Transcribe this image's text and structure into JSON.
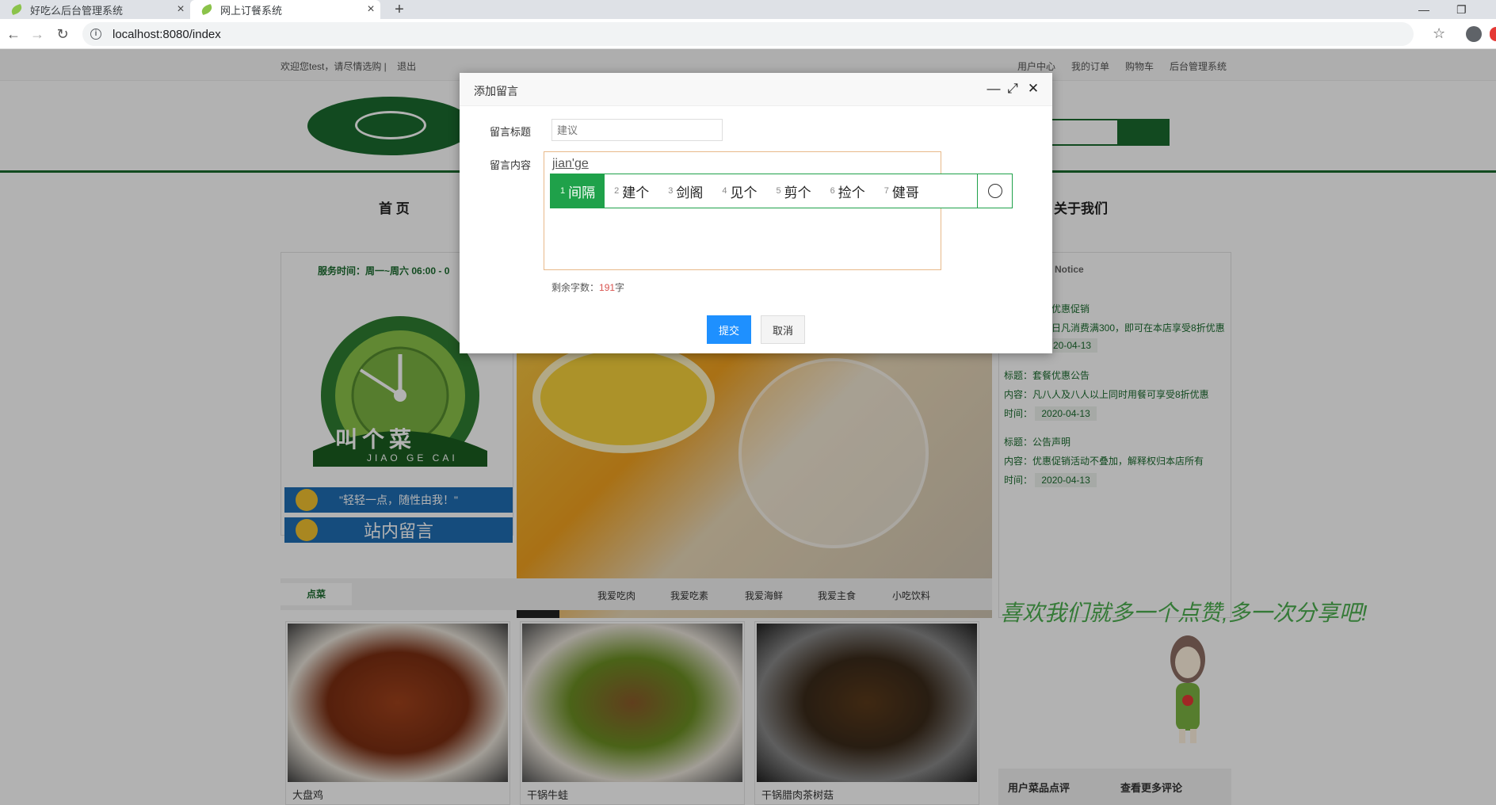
{
  "browser": {
    "tabs": [
      {
        "title": "好吃么后台管理系统"
      },
      {
        "title": "网上订餐系统"
      }
    ],
    "url": "localhost:8080/index"
  },
  "site": {
    "welcome": "欢迎您test，请尽情选购 |",
    "logout": "退出",
    "toplinks": [
      "用户中心",
      "我的订单",
      "购物车",
      "后台管理系统"
    ],
    "nav": {
      "home": "首 页",
      "about": "关于我们"
    },
    "service_time": "服务时间：周一~周六 06:00 - 0",
    "brand": "叫个菜",
    "brand_sub": "JIAO GE CAI",
    "slogan": "\"轻轻一点，随性由我！\"",
    "guestbook": "站内留言",
    "notice": {
      "header": "Notice",
      "items": [
        {
          "title": "优惠促销",
          "content": "日凡消费满300，即可在本店享受8折优惠",
          "time": "20-04-13"
        },
        {
          "title": "标题：套餐优惠公告",
          "content": "内容：凡八人及八人以上同时用餐可享受8折优惠",
          "time_label": "时间：",
          "time": "2020-04-13"
        },
        {
          "title": "标题：公告声明",
          "content": "内容：优惠促销活动不叠加，解释权归本店所有",
          "time_label": "时间：",
          "time": "2020-04-13"
        }
      ]
    },
    "menu_tabs": {
      "active": "点菜",
      "items": [
        "我爱吃肉",
        "我爱吃素",
        "我爱海鲜",
        "我爱主食",
        "小吃饮料"
      ]
    },
    "dishes": [
      "大盘鸡",
      "干锅牛蛙",
      "干锅腊肉茶树菇"
    ],
    "share_text": "喜欢我们就多一个点赞,多一次分享吧!",
    "reviews": {
      "title": "用户菜品点评",
      "more": "查看更多评论"
    }
  },
  "modal": {
    "title": "添加留言",
    "title_label": "留言标题",
    "title_placeholder": "建议",
    "content_label": "留言内容",
    "content_typed": "jian'ge",
    "remain_label": "剩余字数：",
    "remain_count": "191",
    "remain_unit": "字",
    "submit": "提交",
    "cancel": "取消"
  },
  "ime": {
    "candidates": [
      {
        "n": "1",
        "w": "间隔"
      },
      {
        "n": "2",
        "w": "建个"
      },
      {
        "n": "3",
        "w": "剑阁"
      },
      {
        "n": "4",
        "w": "见个"
      },
      {
        "n": "5",
        "w": "剪个"
      },
      {
        "n": "6",
        "w": "捡个"
      },
      {
        "n": "7",
        "w": "健哥"
      }
    ]
  },
  "colors": {
    "brand_green": "#1a6b2e",
    "ime_green": "#1fa14a",
    "submit_blue": "#1e90ff"
  }
}
